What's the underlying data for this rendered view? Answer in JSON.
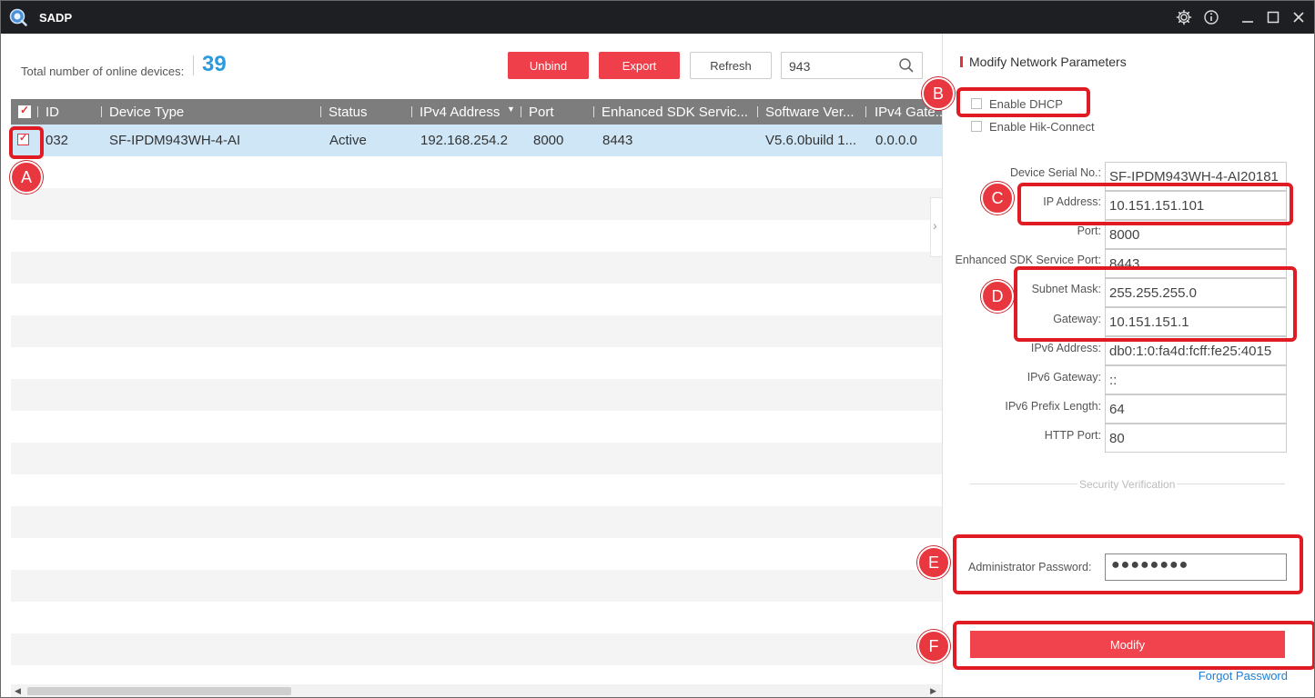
{
  "window": {
    "title": "SADP"
  },
  "toolbar": {
    "total_label": "Total number of online devices:",
    "total_count": "39",
    "unbind_label": "Unbind",
    "export_label": "Export",
    "refresh_label": "Refresh",
    "search_value": "943"
  },
  "table": {
    "headers": [
      "ID",
      "Device Type",
      "Status",
      "IPv4 Address",
      "Port",
      "Enhanced SDK Servic...",
      "Software Ver...",
      "IPv4 Gate..."
    ],
    "rows": [
      {
        "id": "032",
        "device_type": "SF-IPDM943WH-4-AI",
        "status": "Active",
        "ipv4": "192.168.254.2",
        "port": "8000",
        "sdk_port": "8443",
        "software": "V5.6.0build 1...",
        "gateway": "0.0.0.0"
      }
    ]
  },
  "panel": {
    "title": "Modify Network Parameters",
    "enable_dhcp": "Enable DHCP",
    "enable_hik": "Enable Hik-Connect",
    "fields": [
      {
        "label": "Device Serial No.:",
        "value": "SF-IPDM943WH-4-AI20181"
      },
      {
        "label": "IP Address:",
        "value": "10.151.151.101"
      },
      {
        "label": "Port:",
        "value": "8000"
      },
      {
        "label": "Enhanced SDK Service Port:",
        "value": "8443"
      },
      {
        "label": "Subnet Mask:",
        "value": "255.255.255.0"
      },
      {
        "label": "Gateway:",
        "value": "10.151.151.1"
      },
      {
        "label": "IPv6 Address:",
        "value": "db0:1:0:fa4d:fcff:fe25:4015"
      },
      {
        "label": "IPv6 Gateway:",
        "value": "::"
      },
      {
        "label": "IPv6 Prefix Length:",
        "value": "64"
      },
      {
        "label": "HTTP Port:",
        "value": "80"
      }
    ],
    "security_verification": "Security Verification",
    "admin_password_label": "Administrator Password:",
    "admin_password_value": "●●●●●●●●",
    "modify_label": "Modify",
    "forgot_password": "Forgot Password"
  },
  "annotations": {
    "a": "A",
    "b": "B",
    "c": "C",
    "d": "D",
    "e": "E",
    "f": "F"
  },
  "colors": {
    "accent_red": "#ee3f4a",
    "count_blue": "#2b9be0",
    "titlebar": "#1e1f23",
    "selected_row": "#cfe6f7"
  }
}
